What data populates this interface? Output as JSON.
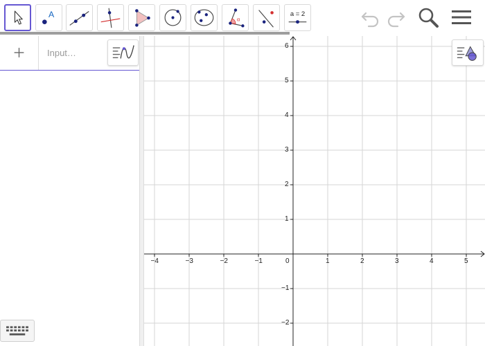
{
  "toolbar": {
    "tools": [
      {
        "name": "move-tool",
        "icon": "arrow-cursor-icon",
        "selected": true
      },
      {
        "name": "point-tool",
        "icon": "point-icon",
        "label": "A",
        "selected": false
      },
      {
        "name": "line-tool",
        "icon": "line-icon",
        "selected": false
      },
      {
        "name": "perpendicular-line-tool",
        "icon": "perpendicular-line-icon",
        "selected": false
      },
      {
        "name": "polygon-tool",
        "icon": "polygon-icon",
        "selected": false
      },
      {
        "name": "circle-center-point-tool",
        "icon": "circle-icon",
        "selected": false
      },
      {
        "name": "ellipse-tool",
        "icon": "ellipse-icon",
        "selected": false
      },
      {
        "name": "angle-tool",
        "icon": "angle-icon",
        "label": "α",
        "selected": false
      },
      {
        "name": "reflect-tool",
        "icon": "reflect-icon",
        "selected": false
      },
      {
        "name": "slider-tool",
        "icon": "slider-icon",
        "label": "a = 2",
        "selected": false
      }
    ],
    "right": [
      {
        "name": "undo-button",
        "icon": "undo-icon"
      },
      {
        "name": "redo-button",
        "icon": "redo-icon"
      },
      {
        "name": "search-button",
        "icon": "search-icon"
      },
      {
        "name": "menu-button",
        "icon": "hamburger-menu-icon"
      }
    ]
  },
  "algebra": {
    "add_icon": "plus-icon",
    "input_placeholder": "Input…",
    "style_button_icon": "algebra-style-icon",
    "keyboard_icon": "keyboard-icon"
  },
  "graphics": {
    "style_button_icon": "graphics-style-icon",
    "x_ticks": [
      "-4",
      "-3",
      "-2",
      "-1",
      "0",
      "1",
      "2",
      "3",
      "4",
      "5"
    ],
    "y_ticks": [
      "6",
      "5",
      "4",
      "3",
      "2",
      "1",
      "-1",
      "-2"
    ],
    "x_range": [
      -4.3,
      5.5
    ],
    "y_range": [
      -2.6,
      6.3
    ],
    "grid": true,
    "colors": {
      "grid": "#d6d6d6",
      "axis": "#222222",
      "accent": "#6557d2"
    }
  }
}
